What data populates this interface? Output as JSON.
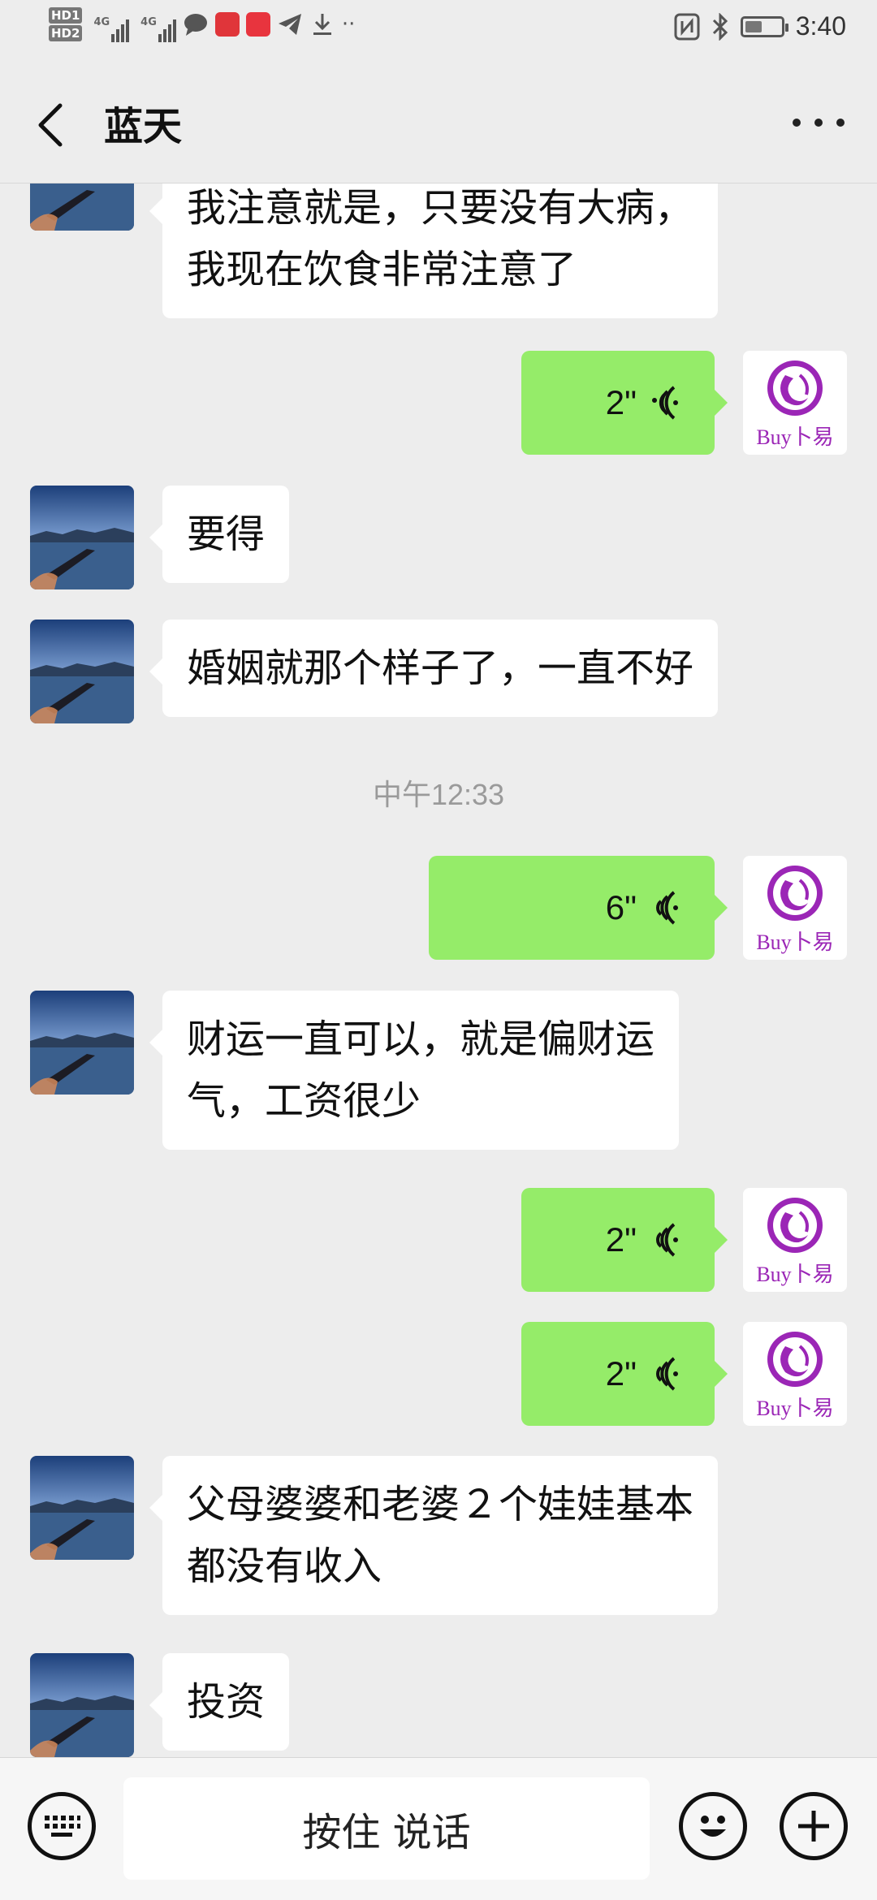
{
  "status_bar": {
    "sim1": "HD1",
    "sim2": "HD2",
    "network1": "4G",
    "network2": "4G",
    "time": "3:40",
    "icons": [
      "message-icon",
      "book-icon",
      "huawei-appgallery-icon",
      "telegram-icon",
      "download-icon",
      "more-dots-icon",
      "nfc-icon",
      "bluetooth-icon",
      "battery-icon"
    ]
  },
  "header": {
    "title": "蓝天",
    "back_icon": "chevron-left-icon",
    "more_icon": "more-horizontal-icon"
  },
  "messages": [
    {
      "side": "left",
      "type": "text",
      "lines": [
        "我注意就是，只要没有大病，",
        "我现在饮食非常注意了"
      ]
    },
    {
      "side": "right",
      "type": "voice",
      "duration": "2\""
    },
    {
      "side": "left",
      "type": "text",
      "lines": [
        "要得"
      ]
    },
    {
      "side": "left",
      "type": "text",
      "lines": [
        "婚姻就那个样子了，一直不好"
      ]
    },
    {
      "type": "timestamp",
      "text": "中午12:33"
    },
    {
      "side": "right",
      "type": "voice",
      "duration": "6\""
    },
    {
      "side": "left",
      "type": "text",
      "lines": [
        "财运一直可以，就是偏财运",
        "气，工资很少"
      ]
    },
    {
      "side": "right",
      "type": "voice",
      "duration": "2\""
    },
    {
      "side": "right",
      "type": "voice",
      "duration": "2\""
    },
    {
      "side": "left",
      "type": "text",
      "lines": [
        "父母婆婆和老婆２个娃娃基本",
        "都没有收入"
      ]
    },
    {
      "side": "left",
      "type": "text",
      "lines": [
        "投资"
      ]
    }
  ],
  "self_avatar_text": "Buy卜易",
  "input_bar": {
    "keyboard_icon": "keyboard-icon",
    "hold_to_talk": "按住 说话",
    "emoji_icon": "emoji-icon",
    "plus_icon": "plus-icon"
  },
  "colors": {
    "background": "#ededed",
    "sent_bubble": "#95ec69",
    "received_bubble": "#ffffff",
    "logo_purple": "#9b26b6"
  }
}
